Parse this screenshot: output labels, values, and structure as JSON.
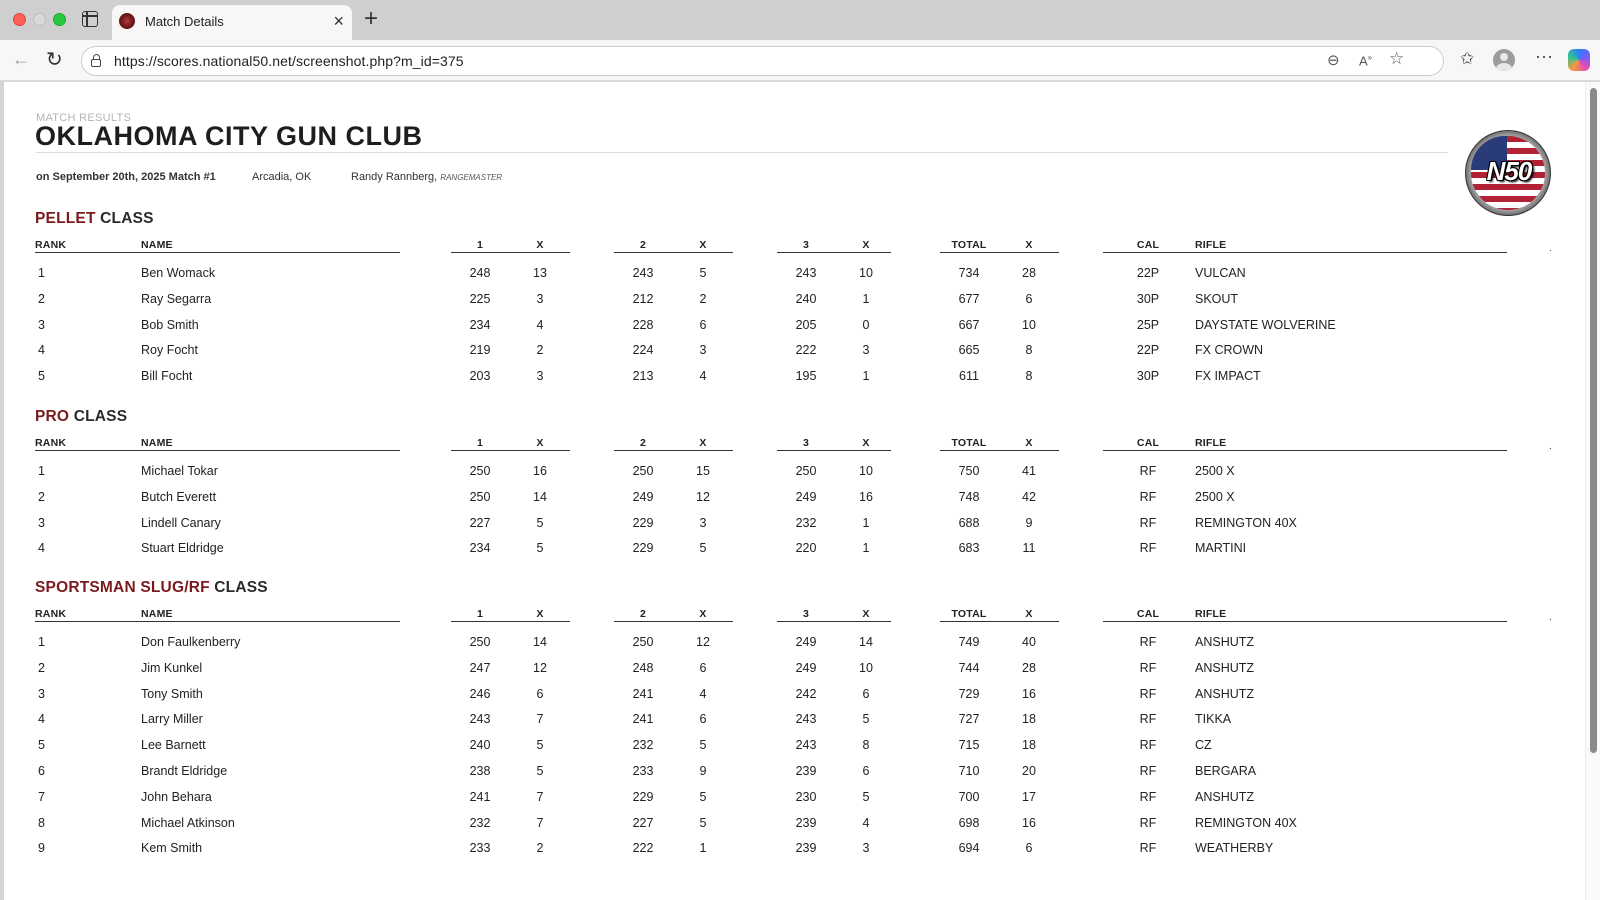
{
  "browser": {
    "tab_title": "Match Details",
    "url": "https://scores.national50.net/screenshot.php?m_id=375"
  },
  "header": {
    "eyebrow": "MATCH RESULTS",
    "club_name": "OKLAHOMA CITY GUN CLUB",
    "date": "on September 20th, 2025 Match #1",
    "location": "Arcadia, OK",
    "rangemaster_name": "Randy Rannberg,",
    "rangemaster_role": "RANGEMASTER",
    "logo_text": "N50"
  },
  "columns": {
    "rank": "RANK",
    "name": "NAME",
    "r1": "1",
    "x1": "X",
    "r2": "2",
    "x2": "X",
    "r3": "3",
    "x3": "X",
    "total": "TOTAL",
    "xt": "X",
    "cal": "CAL",
    "rifle": "RIFLE"
  },
  "classes": [
    {
      "accent": "PELLET",
      "suffix": "CLASS",
      "rows": [
        [
          "1",
          "Ben Womack",
          "248",
          "13",
          "243",
          "5",
          "243",
          "10",
          "734",
          "28",
          "22P",
          "VULCAN"
        ],
        [
          "2",
          "Ray Segarra",
          "225",
          "3",
          "212",
          "2",
          "240",
          "1",
          "677",
          "6",
          "30P",
          "SKOUT"
        ],
        [
          "3",
          "Bob Smith",
          "234",
          "4",
          "228",
          "6",
          "205",
          "0",
          "667",
          "10",
          "25P",
          "DAYSTATE WOLVERINE"
        ],
        [
          "4",
          "Roy Focht",
          "219",
          "2",
          "224",
          "3",
          "222",
          "3",
          "665",
          "8",
          "22P",
          "FX CROWN"
        ],
        [
          "5",
          "Bill Focht",
          "203",
          "3",
          "213",
          "4",
          "195",
          "1",
          "611",
          "8",
          "30P",
          "FX IMPACT"
        ]
      ]
    },
    {
      "accent": "PRO",
      "suffix": "CLASS",
      "rows": [
        [
          "1",
          "Michael Tokar",
          "250",
          "16",
          "250",
          "15",
          "250",
          "10",
          "750",
          "41",
          "RF",
          "2500 X"
        ],
        [
          "2",
          "Butch Everett",
          "250",
          "14",
          "249",
          "12",
          "249",
          "16",
          "748",
          "42",
          "RF",
          "2500 X"
        ],
        [
          "3",
          "Lindell Canary",
          "227",
          "5",
          "229",
          "3",
          "232",
          "1",
          "688",
          "9",
          "RF",
          "REMINGTON 40X"
        ],
        [
          "4",
          "Stuart Eldridge",
          "234",
          "5",
          "229",
          "5",
          "220",
          "1",
          "683",
          "11",
          "RF",
          "MARTINI"
        ]
      ]
    },
    {
      "accent": "SPORTSMAN SLUG/RF",
      "suffix": "CLASS",
      "rows": [
        [
          "1",
          "Don Faulkenberry",
          "250",
          "14",
          "250",
          "12",
          "249",
          "14",
          "749",
          "40",
          "RF",
          "ANSHUTZ"
        ],
        [
          "2",
          "Jim Kunkel",
          "247",
          "12",
          "248",
          "6",
          "249",
          "10",
          "744",
          "28",
          "RF",
          "ANSHUTZ"
        ],
        [
          "3",
          "Tony Smith",
          "246",
          "6",
          "241",
          "4",
          "242",
          "6",
          "729",
          "16",
          "RF",
          "ANSHUTZ"
        ],
        [
          "4",
          "Larry Miller",
          "243",
          "7",
          "241",
          "6",
          "243",
          "5",
          "727",
          "18",
          "RF",
          "TIKKA"
        ],
        [
          "5",
          "Lee Barnett",
          "240",
          "5",
          "232",
          "5",
          "243",
          "8",
          "715",
          "18",
          "RF",
          "CZ"
        ],
        [
          "6",
          "Brandt Eldridge",
          "238",
          "5",
          "233",
          "9",
          "239",
          "6",
          "710",
          "20",
          "RF",
          "BERGARA"
        ],
        [
          "7",
          "John Behara",
          "241",
          "7",
          "229",
          "5",
          "230",
          "5",
          "700",
          "17",
          "RF",
          "ANSHUTZ"
        ],
        [
          "8",
          "Michael Atkinson",
          "232",
          "7",
          "227",
          "5",
          "239",
          "4",
          "698",
          "16",
          "RF",
          "REMINGTON 40X"
        ],
        [
          "9",
          "Kem Smith",
          "233",
          "2",
          "222",
          "1",
          "239",
          "3",
          "694",
          "6",
          "RF",
          "WEATHERBY"
        ]
      ]
    }
  ]
}
